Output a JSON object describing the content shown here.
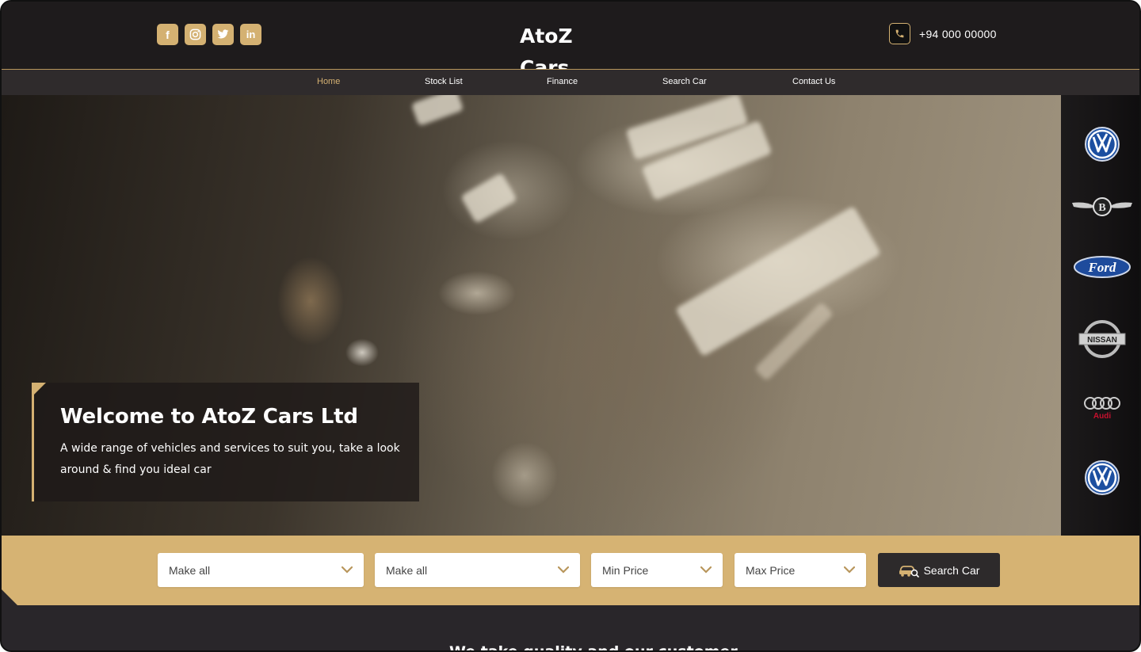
{
  "header": {
    "brand": "AtoZ Cars",
    "phone": "+94 000 00000",
    "social": [
      {
        "icon": "facebook-icon",
        "glyph": "f"
      },
      {
        "icon": "instagram-icon",
        "glyph": ""
      },
      {
        "icon": "twitter-icon",
        "glyph": ""
      },
      {
        "icon": "linkedin-icon",
        "glyph": "in"
      }
    ]
  },
  "nav": {
    "items": [
      {
        "label": "Home",
        "active": true
      },
      {
        "label": "Stock List",
        "active": false
      },
      {
        "label": "Finance",
        "active": false
      },
      {
        "label": "Search Car",
        "active": false
      },
      {
        "label": "Contact Us",
        "active": false
      }
    ]
  },
  "hero": {
    "title": "Welcome to AtoZ Cars Ltd",
    "subtitle": "A wide range of vehicles and services to suit you, take a look around & find you ideal car"
  },
  "brands": [
    {
      "icon": "volkswagen-logo-icon"
    },
    {
      "icon": "bentley-logo-icon",
      "text": "B"
    },
    {
      "icon": "ford-logo-icon",
      "text": "Ford"
    },
    {
      "icon": "nissan-logo-icon",
      "text": "NISSAN"
    },
    {
      "icon": "audi-logo-icon",
      "text": "Audi"
    },
    {
      "icon": "volkswagen-logo-icon"
    }
  ],
  "search": {
    "make1": "Make all",
    "make2": "Make all",
    "min_price": "Min Price",
    "max_price": "Max Price",
    "button": "Search Car"
  },
  "section": {
    "title": "We take quality and our customer"
  },
  "colors": {
    "accent": "#d4b172",
    "dark": "#1e1b1c"
  }
}
